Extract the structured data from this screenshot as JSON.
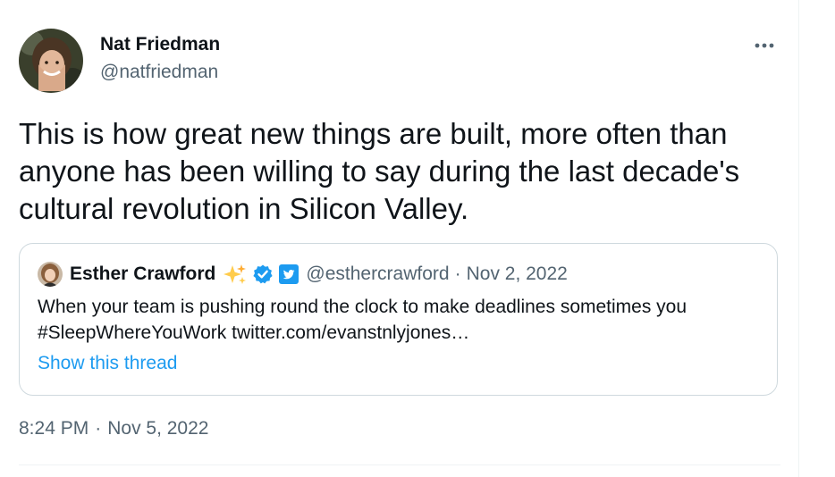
{
  "tweet": {
    "author_name": "Nat Friedman",
    "author_handle": "@natfriedman",
    "more_icon": "more-horizontal-icon",
    "text": "This is how great new things are built, more often than anyone has been willing to say during the last decade's cultural revolution in Silicon Valley.",
    "time": "8:24 PM",
    "separator": "·",
    "date": "Nov 5, 2022"
  },
  "quote": {
    "author_name": "Esther Crawford",
    "emoji_icon": "sparkles-icon",
    "verified_icon": "verified-badge-icon",
    "affiliate_icon": "twitter-badge-icon",
    "author_handle": "@esthercrawford",
    "separator": "·",
    "date": "Nov 2, 2022",
    "text_line1": "When your team is pushing round the clock to make deadlines sometimes you",
    "text_line2": "#SleepWhereYouWork twitter.com/evanstnlyjones…",
    "show_thread": "Show this thread"
  },
  "colors": {
    "text_primary": "#0f1419",
    "text_secondary": "#536471",
    "link": "#1d9bf0",
    "border": "#cfd9de"
  }
}
